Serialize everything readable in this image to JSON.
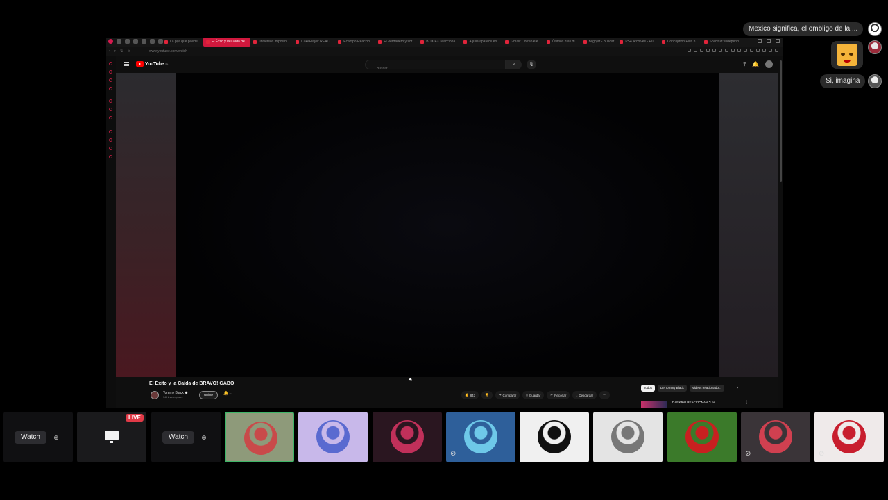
{
  "browser": {
    "tabs": [
      {
        "label": "La pija que puede..."
      },
      {
        "label": "El Éxito y la Caída de..."
      },
      {
        "label": "universos imposibl..."
      },
      {
        "label": "CakeFlayer REAC..."
      },
      {
        "label": "Ecampo Reaccio..."
      },
      {
        "label": "El Verdadero y sor..."
      },
      {
        "label": "BLIXIEX reacciona..."
      },
      {
        "label": "A julia aparece en..."
      },
      {
        "label": "Gmail: Correo ele..."
      },
      {
        "label": "Últimos días di..."
      },
      {
        "label": "negojar - Buscar"
      },
      {
        "label": "PS4 Archives - Pu..."
      },
      {
        "label": "Conception Plus h..."
      },
      {
        "label": "Solicitud: independ..."
      }
    ],
    "active_tab_index": 1,
    "url": "www.youtube.com/watch"
  },
  "youtube": {
    "logo_text": "YouTube",
    "logo_country": "CL",
    "search_placeholder": "Buscar",
    "video_title": "El Éxito y la Caída de BRAVO! GABO",
    "channel_name": "Tommy Black ◉",
    "channel_subs": "144 k suscriptores",
    "join_label": "Unirse",
    "actions": {
      "like": "843",
      "share": "Compartir",
      "save": "Guardar",
      "clip": "Recortar",
      "download": "Descargar"
    },
    "chips": [
      "Todos",
      "De Tommy Black",
      "Videos relacionado..."
    ],
    "recommendation_title": "DARKRAI REACCIONA A \"Los..."
  },
  "chat": {
    "message_1": "Mexico significa, el ombligo de la ...",
    "message_2": "Si, imagina"
  },
  "participants": {
    "watch_label": "Watch",
    "live_label": "LIVE",
    "tiles": [
      {
        "type": "watch"
      },
      {
        "type": "live"
      },
      {
        "type": "watch"
      },
      {
        "type": "avatar",
        "color": "#8e9a7a",
        "accent": "#c94a4a",
        "speaking": true
      },
      {
        "type": "avatar",
        "color": "#c8b8ea",
        "accent": "#5a6ad0"
      },
      {
        "type": "avatar",
        "color": "#2a1620",
        "accent": "#c0305a"
      },
      {
        "type": "avatar",
        "color": "#2e5f9a",
        "accent": "#6ec8e8",
        "muted": true
      },
      {
        "type": "avatar",
        "color": "#f0f0f0",
        "accent": "#111111"
      },
      {
        "type": "avatar",
        "color": "#e4e4e4",
        "accent": "#777777"
      },
      {
        "type": "avatar",
        "color": "#3b7a2a",
        "accent": "#c82020"
      },
      {
        "type": "avatar",
        "color": "#3a3438",
        "accent": "#d04050",
        "muted": true
      },
      {
        "type": "avatar",
        "color": "#efeaea",
        "accent": "#c81e2e",
        "muted": true
      }
    ]
  },
  "colors": {
    "accent_red": "#d0183d",
    "speaking_green": "#3fb568",
    "live_red": "#e03a47"
  }
}
